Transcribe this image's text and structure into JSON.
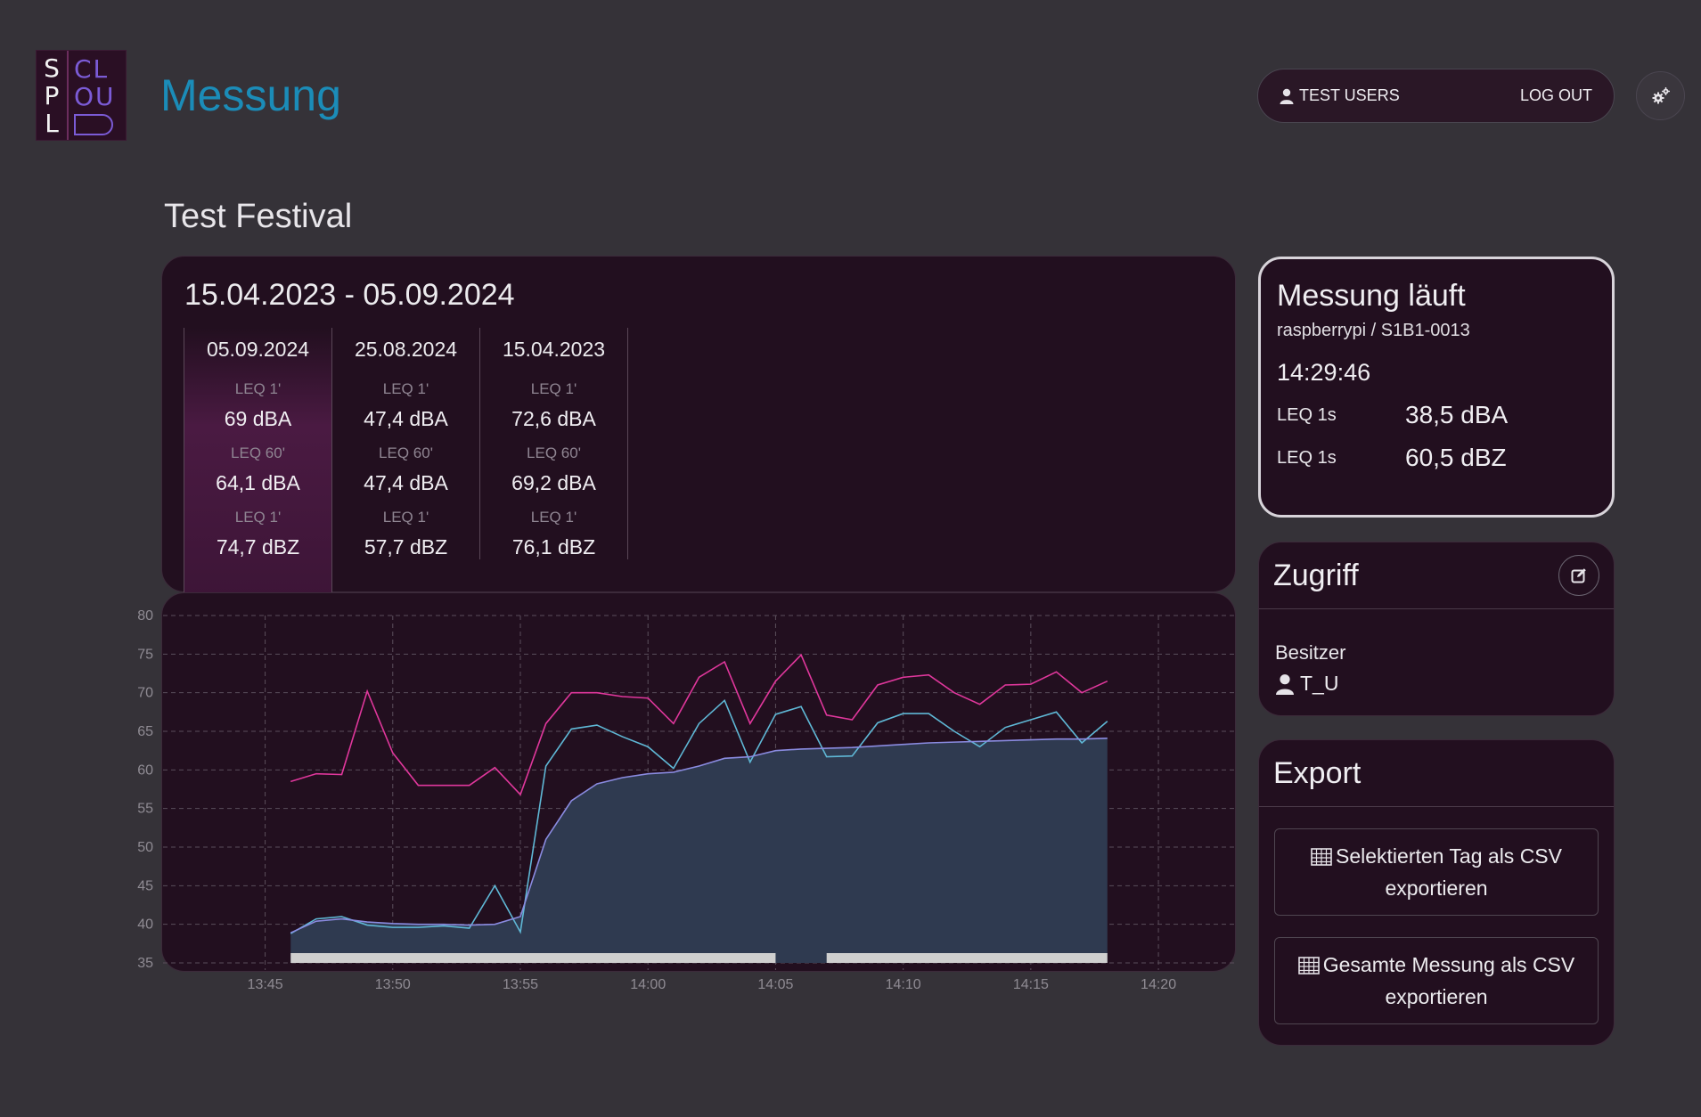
{
  "logo": {
    "col1": [
      "S",
      "P",
      "L"
    ],
    "col2": [
      "CL",
      "OU"
    ]
  },
  "header": {
    "title": "Messung",
    "user_label": "TEST USERS",
    "logout_label": "LOG OUT",
    "user_icon": "user-icon",
    "settings_icon": "gear-icon"
  },
  "project": {
    "name": "Test Festival"
  },
  "days": {
    "range": "15.04.2023 - 05.09.2024",
    "columns": [
      {
        "date": "05.09.2024",
        "selected": true,
        "metrics": [
          {
            "label": "LEQ 1'",
            "value": "69 dBA"
          },
          {
            "label": "LEQ 60'",
            "value": "64,1 dBA"
          },
          {
            "label": "LEQ 1'",
            "value": "74,7 dBZ"
          }
        ]
      },
      {
        "date": "25.08.2024",
        "selected": false,
        "metrics": [
          {
            "label": "LEQ 1'",
            "value": "47,4 dBA"
          },
          {
            "label": "LEQ 60'",
            "value": "47,4 dBA"
          },
          {
            "label": "LEQ 1'",
            "value": "57,7 dBZ"
          }
        ]
      },
      {
        "date": "15.04.2023",
        "selected": false,
        "metrics": [
          {
            "label": "LEQ 1'",
            "value": "72,6 dBA"
          },
          {
            "label": "LEQ 60'",
            "value": "69,2 dBA"
          },
          {
            "label": "LEQ 1'",
            "value": "76,1 dBZ"
          }
        ]
      }
    ]
  },
  "live": {
    "title": "Messung läuft",
    "device": "raspberrypi / S1B1-0013",
    "time": "14:29:46",
    "rows": [
      {
        "label": "LEQ 1s",
        "value": "38,5 dBA"
      },
      {
        "label": "LEQ 1s",
        "value": "60,5 dBZ"
      }
    ]
  },
  "access": {
    "title": "Zugriff",
    "edit_icon": "edit-icon",
    "owner_label": "Besitzer",
    "owner_value": "T_U"
  },
  "export": {
    "title": "Export",
    "buttons": [
      {
        "label": "Selektierten Tag als CSV exportieren",
        "icon": "table-icon"
      },
      {
        "label": "Gesamte Messung als CSV exportieren",
        "icon": "table-icon"
      }
    ]
  },
  "chart_data": {
    "type": "line",
    "ylim": [
      35,
      80
    ],
    "yticks": [
      35,
      40,
      45,
      50,
      55,
      60,
      65,
      70,
      75,
      80
    ],
    "xlim": [
      "13:41",
      "14:23"
    ],
    "xticks": [
      "13:45",
      "13:50",
      "13:55",
      "14:00",
      "14:05",
      "14:10",
      "14:15",
      "14:20"
    ],
    "grid": true,
    "colors": {
      "dbz": "#e0379c",
      "dba": "#5fb8d6",
      "leq60": "#8a8be0",
      "area": "#2f3a50",
      "coverage": "#cfcfcf"
    },
    "x": [
      "13:46",
      "13:47",
      "13:48",
      "13:49",
      "13:50",
      "13:51",
      "13:52",
      "13:53",
      "13:54",
      "13:55",
      "13:56",
      "13:57",
      "13:58",
      "13:59",
      "14:00",
      "14:01",
      "14:02",
      "14:03",
      "14:04",
      "14:05",
      "14:06",
      "14:07",
      "14:08",
      "14:09",
      "14:10",
      "14:11",
      "14:12",
      "14:13",
      "14:14",
      "14:15",
      "14:16",
      "14:17",
      "14:18"
    ],
    "series": [
      {
        "key": "dbz",
        "values": [
          58.5,
          59.5,
          59.4,
          70.2,
          62.2,
          58.0,
          58.0,
          58.0,
          60.3,
          56.8,
          66.0,
          70.0,
          70.0,
          69.5,
          69.3,
          66.0,
          72.0,
          74.0,
          66.0,
          71.5,
          74.9,
          67.1,
          66.5,
          71.0,
          72.0,
          72.3,
          70.0,
          68.5,
          71.0,
          71.1,
          72.7,
          70.0,
          71.5
        ]
      },
      {
        "key": "dba",
        "values": [
          38.8,
          40.7,
          41.0,
          39.9,
          39.6,
          39.6,
          39.8,
          39.5,
          45.0,
          39.0,
          60.5,
          65.3,
          65.8,
          64.3,
          63.0,
          60.2,
          66.0,
          69.0,
          61.0,
          67.2,
          68.2,
          61.7,
          61.8,
          66.1,
          67.3,
          67.3,
          65.0,
          63.0,
          65.5,
          66.5,
          67.5,
          63.5,
          66.3
        ]
      },
      {
        "key": "leq60",
        "values": [
          38.9,
          40.4,
          40.7,
          40.3,
          40.1,
          40.0,
          40.0,
          39.9,
          40.0,
          41.0,
          51.0,
          56.0,
          58.2,
          59.0,
          59.5,
          59.7,
          60.5,
          61.5,
          61.7,
          62.5,
          62.7,
          62.8,
          62.9,
          63.1,
          63.3,
          63.5,
          63.6,
          63.7,
          63.8,
          63.9,
          64.0,
          64.0,
          64.1
        ]
      }
    ],
    "coverage": [
      {
        "from": "13:46",
        "to": "14:05"
      },
      {
        "from": "14:07",
        "to": "14:18"
      }
    ]
  }
}
